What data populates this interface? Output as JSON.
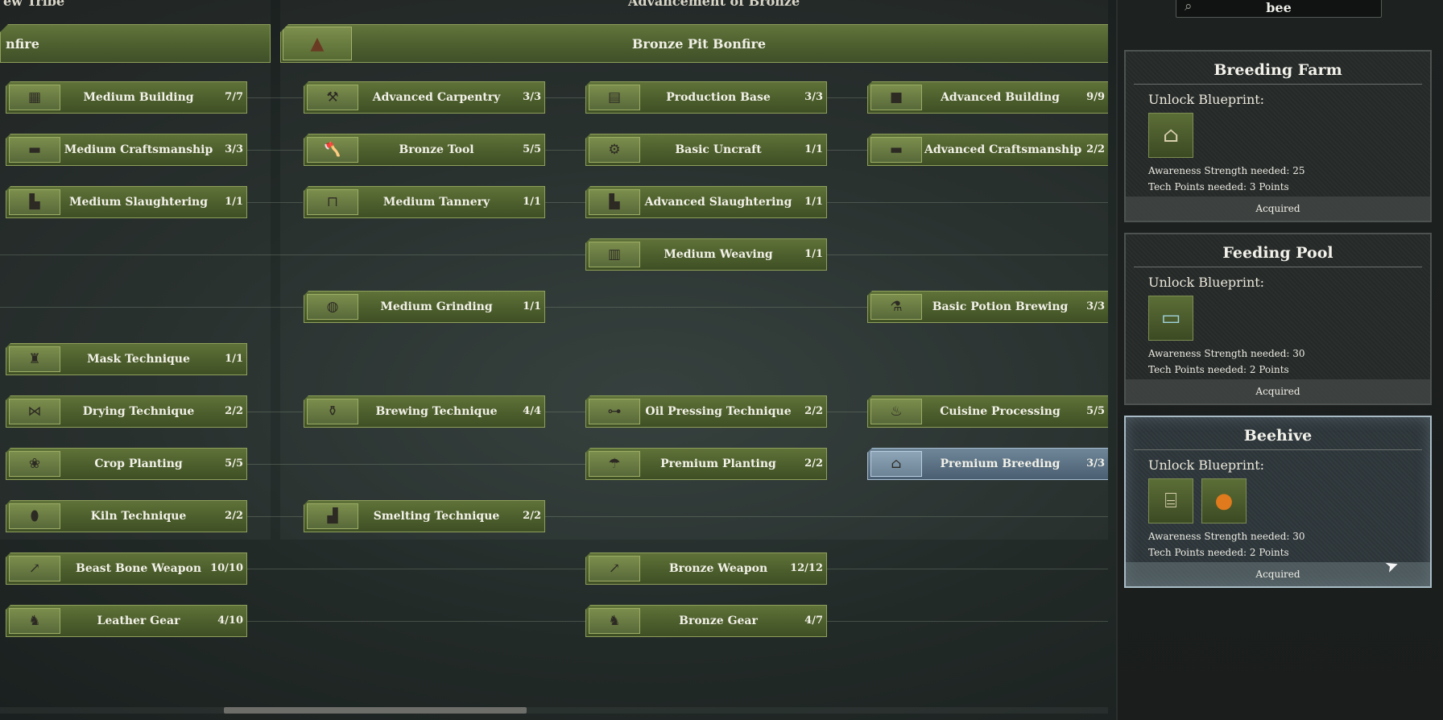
{
  "top": {
    "left_title": "ew Tribe",
    "center_title": "Advancement of Bronze"
  },
  "headers": {
    "left": "nfire",
    "center": "Bronze Pit Bonfire"
  },
  "nodes": [
    {
      "name": "Medium Building",
      "count": "7/7",
      "icon": "building-icon"
    },
    {
      "name": "Medium Craftsmanship",
      "count": "3/3",
      "icon": "workbench-icon"
    },
    {
      "name": "Medium Slaughtering",
      "count": "1/1",
      "icon": "slaughter-table-icon"
    },
    {
      "name": "Mask Technique",
      "count": "1/1",
      "icon": "mask-icon"
    },
    {
      "name": "Drying Technique",
      "count": "2/2",
      "icon": "drying-rack-icon"
    },
    {
      "name": "Crop Planting",
      "count": "5/5",
      "icon": "crop-icon"
    },
    {
      "name": "Kiln Technique",
      "count": "2/2",
      "icon": "kiln-icon"
    },
    {
      "name": "Beast Bone Weapon",
      "count": "10/10",
      "icon": "spear-icon"
    },
    {
      "name": "Leather Gear",
      "count": "4/10",
      "icon": "leather-armor-icon"
    },
    {
      "name": "Advanced Carpentry",
      "count": "3/3",
      "icon": "carpentry-icon"
    },
    {
      "name": "Bronze Tool",
      "count": "5/5",
      "icon": "axe-icon"
    },
    {
      "name": "Medium Tannery",
      "count": "1/1",
      "icon": "tannery-icon"
    },
    {
      "name": "Medium Grinding",
      "count": "1/1",
      "icon": "grinder-icon"
    },
    {
      "name": "Brewing Technique",
      "count": "4/4",
      "icon": "brew-pot-icon"
    },
    {
      "name": "Smelting Technique",
      "count": "2/2",
      "icon": "smelter-icon"
    },
    {
      "name": "Production Base",
      "count": "3/3",
      "icon": "production-base-icon"
    },
    {
      "name": "Basic Uncraft",
      "count": "1/1",
      "icon": "uncraft-icon"
    },
    {
      "name": "Advanced Slaughtering",
      "count": "1/1",
      "icon": "slaughter-table-icon"
    },
    {
      "name": "Medium Weaving",
      "count": "1/1",
      "icon": "loom-icon"
    },
    {
      "name": "Oil Pressing Technique",
      "count": "2/2",
      "icon": "oil-press-icon"
    },
    {
      "name": "Premium Planting",
      "count": "2/2",
      "icon": "planting-icon"
    },
    {
      "name": "Bronze Weapon",
      "count": "12/12",
      "icon": "bronze-spear-icon"
    },
    {
      "name": "Bronze Gear",
      "count": "4/7",
      "icon": "bronze-armor-icon"
    },
    {
      "name": "Advanced Building",
      "count": "9/9",
      "icon": "stone-block-icon"
    },
    {
      "name": "Advanced Craftsmanship",
      "count": "2/2",
      "icon": "workbench-icon"
    },
    {
      "name": "Basic Potion Brewing",
      "count": "3/3",
      "icon": "potion-station-icon"
    },
    {
      "name": "Cuisine Processing",
      "count": "5/5",
      "icon": "cooking-icon"
    },
    {
      "name": "Premium Breeding",
      "count": "3/3",
      "icon": "breeding-icon"
    }
  ],
  "search": {
    "value": "bee"
  },
  "cards": [
    {
      "title": "Breeding Farm",
      "unlock_label": "Unlock Blueprint:",
      "awareness": "Awareness Strength needed: 25",
      "tech": "Tech Points needed: 3 Points",
      "status": "Acquired",
      "icons": [
        "breeding-farm-icon"
      ]
    },
    {
      "title": "Feeding Pool",
      "unlock_label": "Unlock Blueprint:",
      "awareness": "Awareness Strength needed: 30",
      "tech": "Tech Points needed: 2 Points",
      "status": "Acquired",
      "icons": [
        "feeding-pool-icon"
      ]
    },
    {
      "title": "Beehive",
      "unlock_label": "Unlock Blueprint:",
      "awareness": "Awareness Strength needed: 30",
      "tech": "Tech Points needed: 2 Points",
      "status": "Acquired",
      "icons": [
        "beehive-icon",
        "honey-jar-icon"
      ]
    }
  ],
  "colors": {
    "node_green": "#55682f",
    "highlight_blue": "#5b7183",
    "active_card_border": "#a9bcc6"
  }
}
